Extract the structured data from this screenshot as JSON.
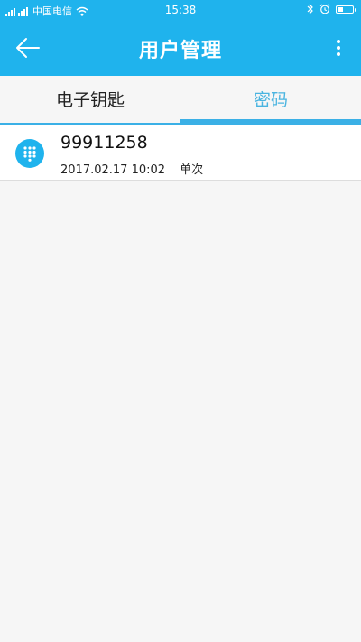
{
  "status_bar": {
    "carrier": "中国电信",
    "time": "15:38",
    "battery_level": 0.4
  },
  "header": {
    "title": "用户管理"
  },
  "tabs": [
    {
      "label": "电子钥匙",
      "active": false
    },
    {
      "label": "密码",
      "active": true
    }
  ],
  "passwords": [
    {
      "code": "99911258",
      "date": "2017.02.17 10:02",
      "type": "单次",
      "icon": "keypad-icon"
    }
  ],
  "icons": {
    "back": "arrow-left-icon",
    "more": "more-vertical-icon",
    "bluetooth": "bluetooth-icon",
    "alarm": "alarm-icon",
    "wifi": "wifi-icon",
    "signal": "signal-icon",
    "battery": "battery-icon"
  },
  "colors": {
    "primary": "#1fb3ed",
    "tab_active": "#4ab4e0",
    "background": "#f6f6f6"
  }
}
